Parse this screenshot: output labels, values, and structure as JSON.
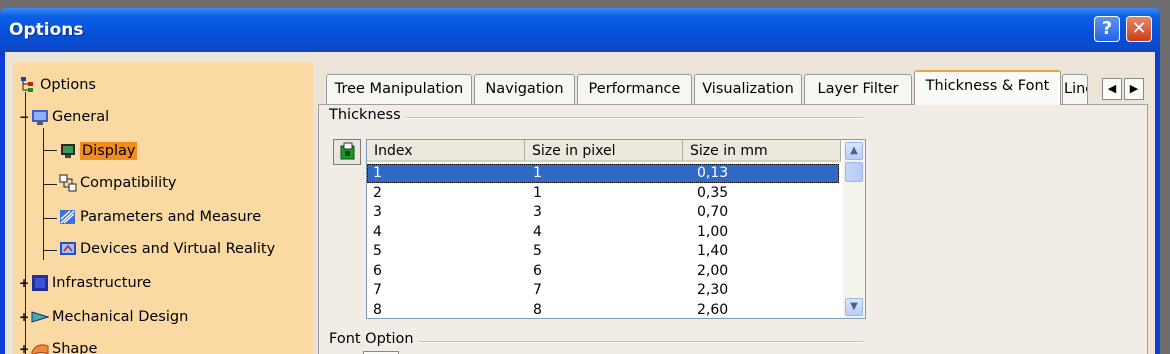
{
  "window": {
    "title": "Options",
    "help_glyph": "?",
    "close_glyph": "✕"
  },
  "tree": {
    "root": "Options",
    "items": [
      {
        "label": "General",
        "icon": "general-icon"
      },
      {
        "label": "Display",
        "icon": "display-icon",
        "selected": true
      },
      {
        "label": "Compatibility",
        "icon": "compatibility-icon"
      },
      {
        "label": "Parameters and Measure",
        "icon": "parameters-icon"
      },
      {
        "label": "Devices and Virtual Reality",
        "icon": "devices-icon"
      },
      {
        "label": "Infrastructure",
        "icon": "infrastructure-icon"
      },
      {
        "label": "Mechanical Design",
        "icon": "mechanical-design-icon"
      },
      {
        "label": "Shape",
        "icon": "shape-icon"
      }
    ]
  },
  "tabs": [
    {
      "label": "Tree Manipulation"
    },
    {
      "label": "Navigation"
    },
    {
      "label": "Performance"
    },
    {
      "label": "Visualization"
    },
    {
      "label": "Layer Filter"
    },
    {
      "label": "Thickness & Font",
      "active": true
    },
    {
      "label": "Line"
    }
  ],
  "thickness": {
    "group_title": "Thickness",
    "columns": [
      "Index",
      "Size in pixel",
      "Size in mm"
    ],
    "rows": [
      [
        "1",
        "1",
        "0,13"
      ],
      [
        "2",
        "1",
        "0,35"
      ],
      [
        "3",
        "3",
        "0,70"
      ],
      [
        "4",
        "4",
        "1,00"
      ],
      [
        "5",
        "5",
        "1,40"
      ],
      [
        "6",
        "6",
        "2,00"
      ],
      [
        "7",
        "7",
        "2,30"
      ],
      [
        "8",
        "8",
        "2,60"
      ]
    ],
    "selected_row": 0
  },
  "font_option": {
    "group_title": "Font Option"
  },
  "colors": {
    "title_bar": "#0552da",
    "selection": "#316ac5",
    "tree_background": "#fad9a3",
    "tree_selection": "#f28c1e"
  }
}
